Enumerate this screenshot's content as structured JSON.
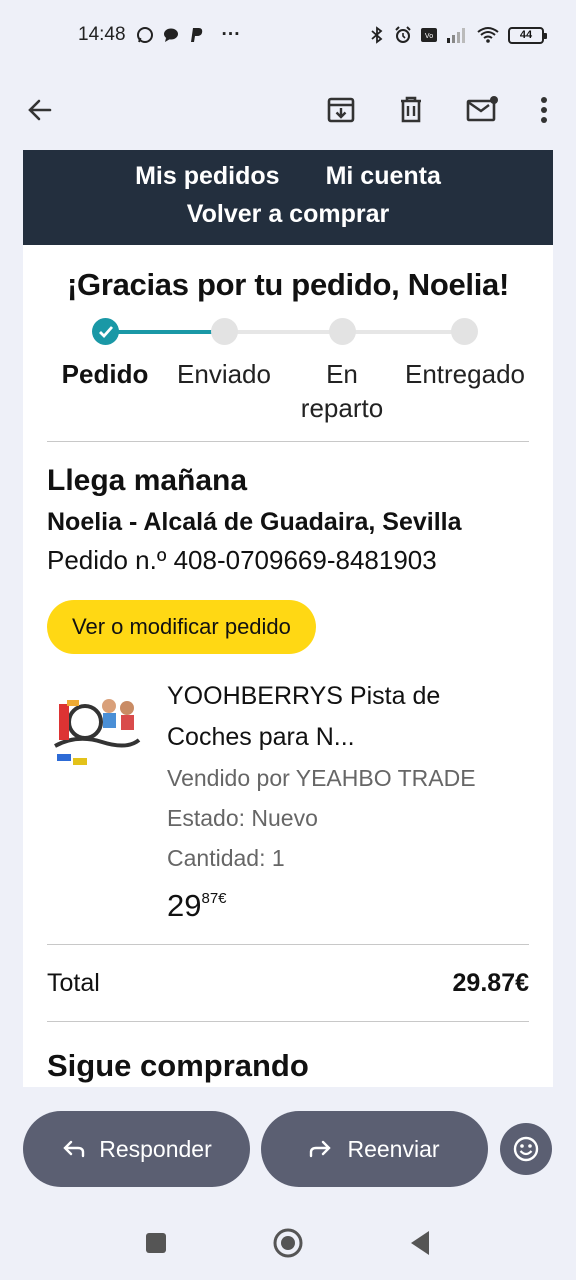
{
  "status_bar": {
    "time": "14:48",
    "more": "···",
    "battery": "44",
    "icons": [
      "whatsapp-icon",
      "chat-icon",
      "paypal-icon",
      "bluetooth-icon",
      "alarm-icon",
      "volte-icon",
      "signal-icon",
      "wifi-icon"
    ]
  },
  "toolbar": {
    "icons": [
      "back-arrow-icon",
      "archive-icon",
      "delete-icon",
      "mark-unread-icon",
      "more-vert-icon"
    ]
  },
  "email": {
    "nav": {
      "orders": "Mis pedidos",
      "account": "Mi cuenta",
      "buy_again": "Volver a comprar"
    },
    "thanks": "¡Gracias por tu pedido, Noelia!",
    "steps": [
      {
        "line1": "Pedido",
        "line2": "",
        "done": true
      },
      {
        "line1": "Enviado",
        "line2": "",
        "done": false
      },
      {
        "line1": "En",
        "line2": "reparto",
        "done": false
      },
      {
        "line1": "Entregado",
        "line2": "",
        "done": false
      }
    ],
    "arrival": "Llega mañana",
    "address": "Noelia - Alcalá de Guadaira, Sevilla",
    "order_number": "Pedido n.º 408-0709669-8481903",
    "modify_button": "Ver o modificar pedido",
    "item": {
      "title_line1": "YOOHBERRYS Pista de",
      "title_line2": "Coches para N...",
      "seller": "Vendido por YEAHBO TRADE",
      "condition": "Estado: Nuevo",
      "quantity": "Cantidad: 1",
      "price_whole": "29",
      "price_fraction": "87€"
    },
    "total_label": "Total",
    "total_value": "29.87€",
    "keep_shopping": "Sigue comprando"
  },
  "actions": {
    "reply": "Responder",
    "forward": "Reenviar"
  },
  "colors": {
    "nav_bg": "#232f3e",
    "progress": "#1a98a6",
    "button_yellow": "#ffd814",
    "action_bg": "#5b5f72",
    "page_bg": "#eef0f8"
  }
}
